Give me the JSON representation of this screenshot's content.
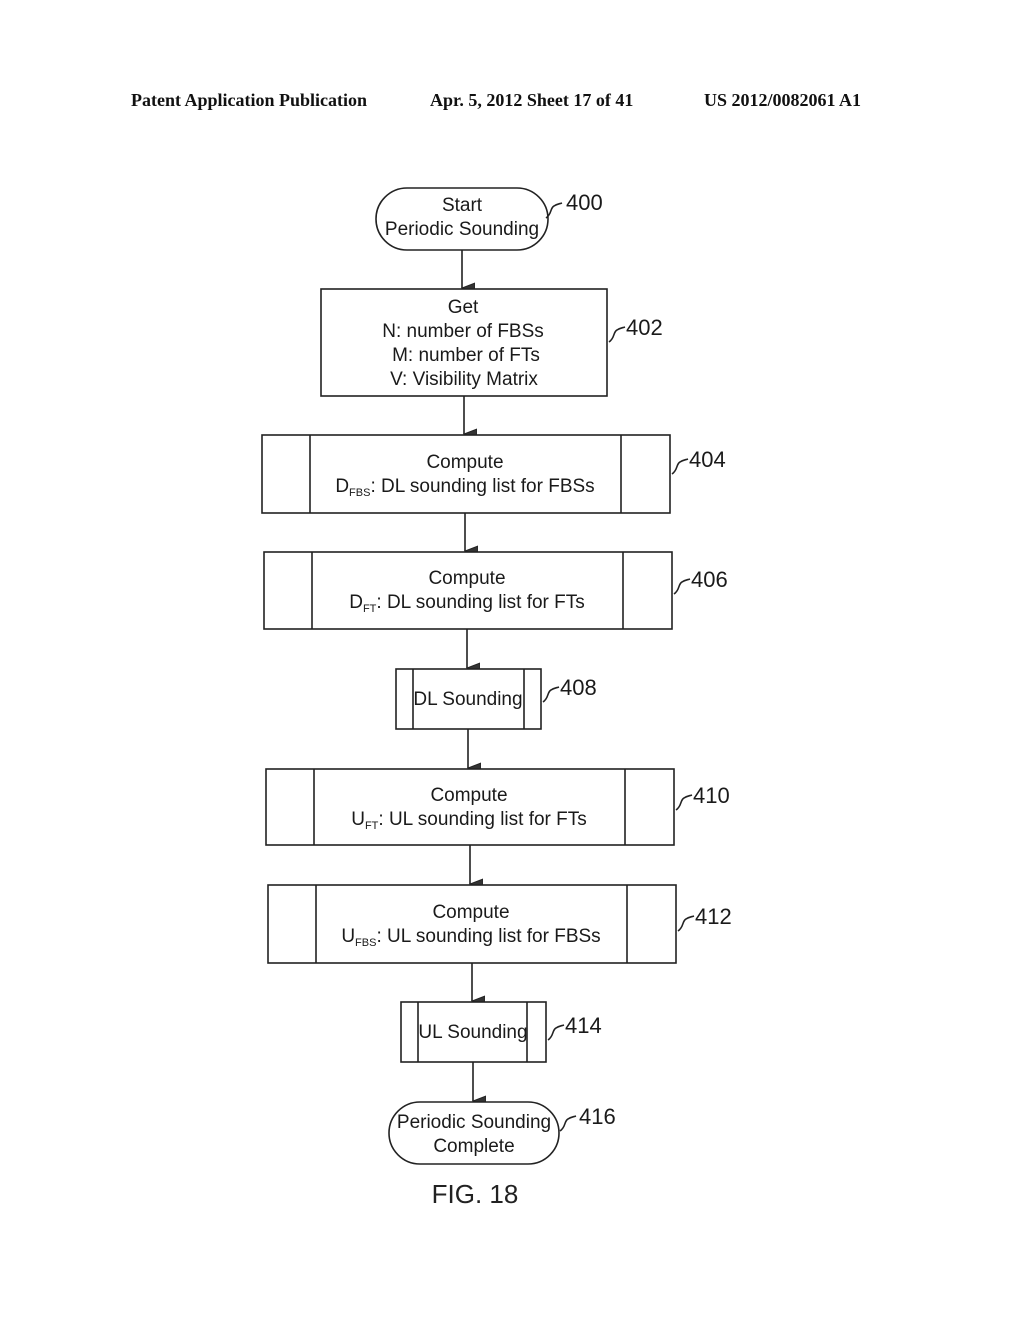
{
  "header": {
    "left": "Patent Application Publication",
    "middle": "Apr. 5, 2012   Sheet 17 of 41",
    "right": "US 2012/0082061 A1"
  },
  "figure_label": "FIG. 18",
  "nodes": [
    {
      "id": "400",
      "type": "terminal",
      "lines": [
        "Start",
        "Periodic Sounding"
      ]
    },
    {
      "id": "402",
      "type": "process",
      "lines": [
        "Get",
        "N: number of FBSs",
        "M: number of FTs",
        "V: Visibility Matrix"
      ]
    },
    {
      "id": "404",
      "type": "predefined",
      "title": "Compute",
      "symbol": "D",
      "subscript": "FBS",
      "text": ": DL sounding list for FBSs"
    },
    {
      "id": "406",
      "type": "predefined",
      "title": "Compute",
      "symbol": "D",
      "subscript": "FT",
      "text": ": DL sounding list for FTs"
    },
    {
      "id": "408",
      "type": "predefined",
      "label": "DL Sounding"
    },
    {
      "id": "410",
      "type": "predefined",
      "title": "Compute",
      "symbol": "U",
      "subscript": "FT",
      "text": ": UL sounding list for FTs"
    },
    {
      "id": "412",
      "type": "predefined",
      "title": "Compute",
      "symbol": "U",
      "subscript": "FBS",
      "text": ": UL sounding list for FBSs"
    },
    {
      "id": "414",
      "type": "predefined",
      "label": "UL Sounding"
    },
    {
      "id": "416",
      "type": "terminal",
      "lines": [
        "Periodic Sounding",
        "Complete"
      ]
    }
  ],
  "edges": [
    [
      "400",
      "402"
    ],
    [
      "402",
      "404"
    ],
    [
      "404",
      "406"
    ],
    [
      "406",
      "408"
    ],
    [
      "408",
      "410"
    ],
    [
      "410",
      "412"
    ],
    [
      "412",
      "414"
    ],
    [
      "414",
      "416"
    ]
  ]
}
